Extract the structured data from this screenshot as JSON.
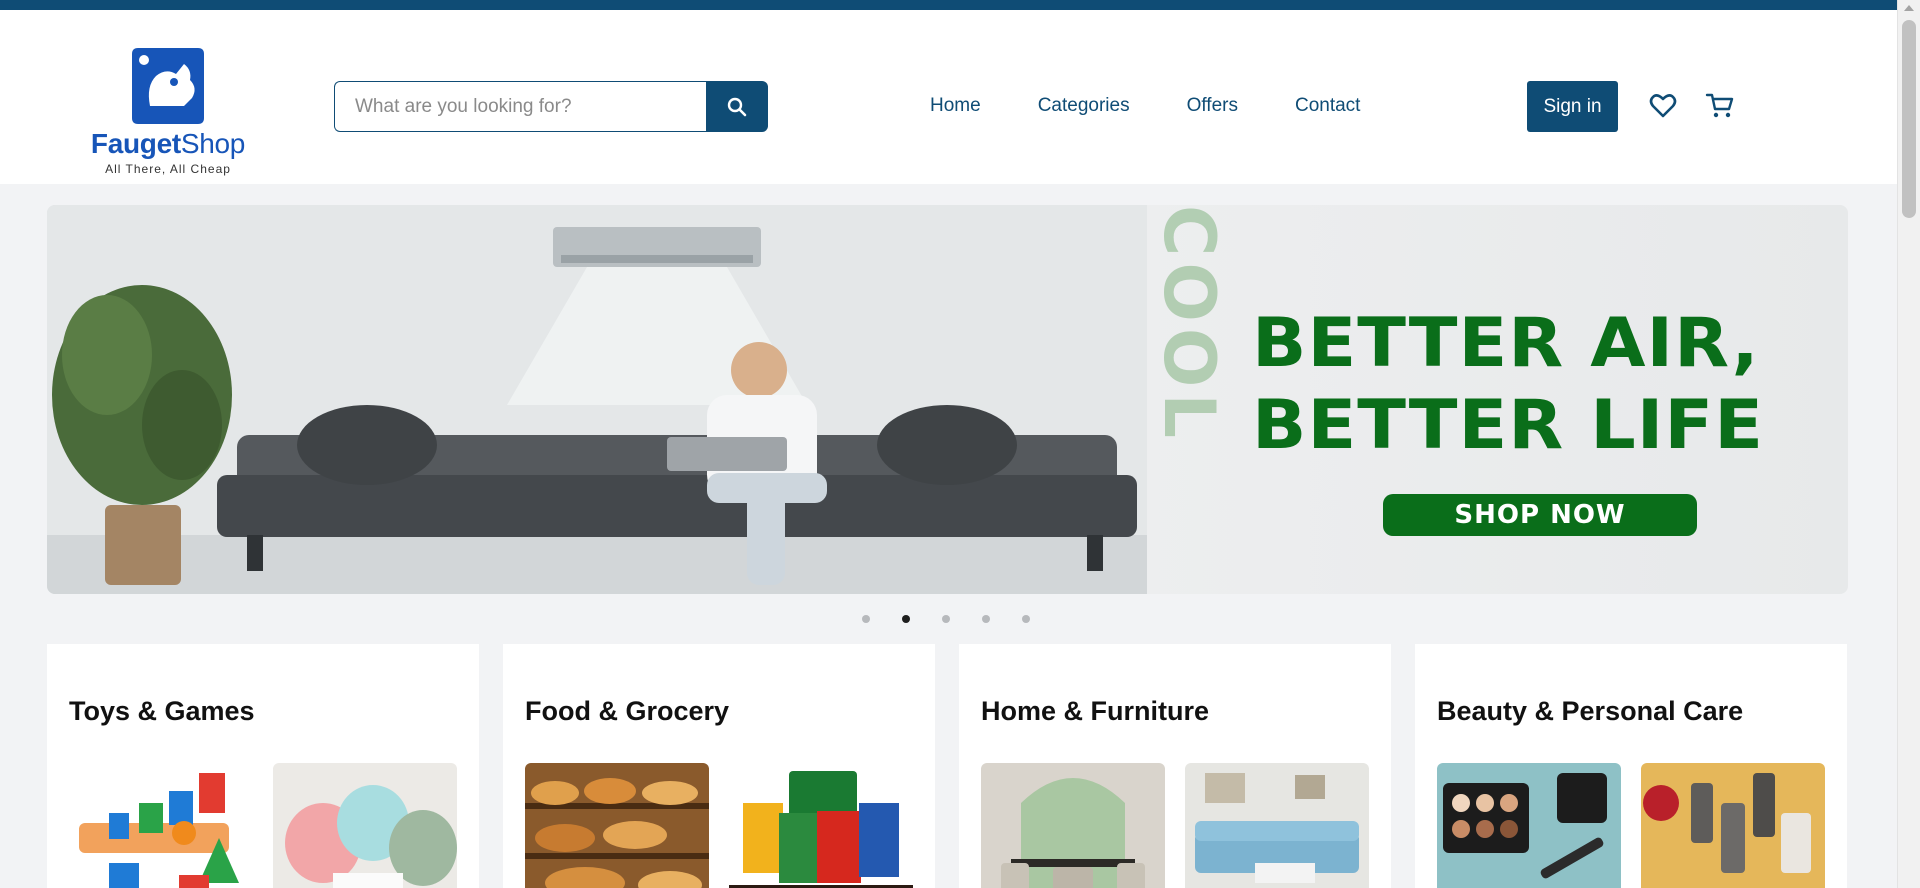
{
  "brand": {
    "name_part1": "Fauget",
    "name_part2": "Shop",
    "tagline": "All There, All Cheap",
    "color": "#1755b8"
  },
  "search": {
    "placeholder": "What are you looking for?",
    "value": "",
    "icon": "search-icon"
  },
  "nav": {
    "items": [
      {
        "label": "Home"
      },
      {
        "label": "Categories"
      },
      {
        "label": "Offers"
      },
      {
        "label": "Contact"
      }
    ]
  },
  "header_actions": {
    "signin_label": "Sign in",
    "wishlist_icon": "heart-icon",
    "cart_icon": "cart-icon"
  },
  "hero": {
    "side_text": "COOL COOL COOL",
    "headline_line1": "BETTER AIR,",
    "headline_line2": "BETTER LIFE",
    "cta_label": "SHOP NOW",
    "accent_color": "#0a6e1a"
  },
  "carousel": {
    "slide_count": 5,
    "active_index": 1
  },
  "categories": [
    {
      "title": "Toys & Games"
    },
    {
      "title": "Food & Grocery"
    },
    {
      "title": "Home & Furniture"
    },
    {
      "title": "Beauty & Personal Care"
    }
  ],
  "theme": {
    "primary": "#0f4c75",
    "page_bg": "#f2f3f5"
  }
}
